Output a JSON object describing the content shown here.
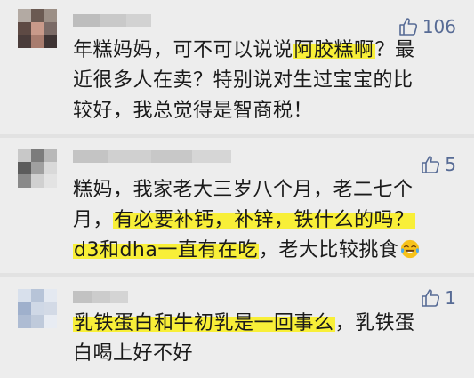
{
  "comments": [
    {
      "likes": "106",
      "line1_a": "年糕妈妈，可不可以说说",
      "line1_hl": "阿胶糕啊",
      "line1_b": "？最",
      "line2": "近很多人在卖？特别说对生过宝宝的比",
      "line3": "较好，我总觉得是智商税！"
    },
    {
      "likes": "5",
      "line1": "糕妈，我家老大三岁八个月，老二七个",
      "line2_a": "月，",
      "line2_hl": "有必要补钙，补锌，铁什么的吗？",
      "line3_hl": "d3和dha一直有在吃",
      "line3_b": "，老大比较挑食",
      "emoji": "crying-laughing-face"
    },
    {
      "likes": "1",
      "line1_hl": "乳铁蛋白和牛初乳是一回事么",
      "line1_b": "，乳铁蛋",
      "line2": "白喝上好不好"
    }
  ],
  "colors": {
    "background": "#ededed",
    "text": "#1a1a1a",
    "like_blue": "#576b95",
    "highlight": "#f8ef38"
  }
}
